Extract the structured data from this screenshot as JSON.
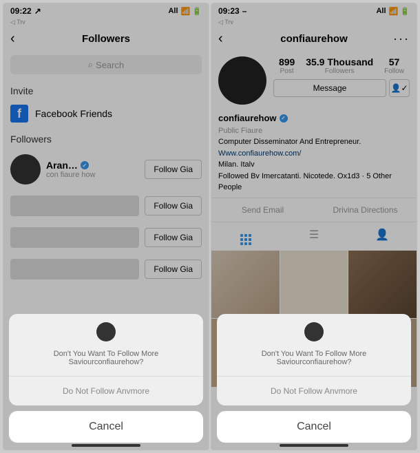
{
  "left": {
    "status": {
      "time": "09:22",
      "near": "↗",
      "try": "◁ Trv",
      "carrier": "All",
      "icons": "📶 🔋"
    },
    "nav": {
      "title": "Followers"
    },
    "search": {
      "placeholder": "Search"
    },
    "invite_label": "Invite",
    "fb_label": "Facebook Friends",
    "followers_label": "Followers",
    "rows": [
      {
        "name": "Aran…",
        "handle": "con fiaure how",
        "btn": "Follow Gia"
      },
      {
        "btn": "Follow Gia"
      },
      {
        "btn": "Follow Gia"
      },
      {
        "btn": "Follow Gia"
      }
    ],
    "sheet": {
      "message": "Don't You Want To Follow More Saviourconfiaurehow?",
      "option": "Do Not Follow Anvmore",
      "cancel": "Cancel"
    }
  },
  "right": {
    "status": {
      "time": "09:23",
      "near": "–",
      "try": "◁ Trv",
      "carrier": "All",
      "icons": "📶 🔋"
    },
    "nav": {
      "title": "confiaurehow"
    },
    "stats": [
      {
        "n": "899",
        "l": "Post"
      },
      {
        "n": "35.9 Thousand",
        "l": "Followers"
      },
      {
        "n": "57",
        "l": "Follow"
      }
    ],
    "message_btn": "Message",
    "bio": {
      "username": "confiaurehow",
      "category": "Public Fiaure",
      "line1": "Computer Disseminator And Entrepreneur.",
      "link": "Www.confiaurehow.com/",
      "location": "Milan. Italv",
      "followed": "Followed Bv Imercatanti. Nicotede. Ox1d3 · 5 Other People"
    },
    "contact": {
      "email": "Send Email",
      "directions": "Drivina Directions"
    },
    "sheet": {
      "message": "Don't You Want To Follow More Saviourconfiaurehow?",
      "option": "Do Not Follow Anvmore",
      "cancel": "Cancel"
    }
  }
}
